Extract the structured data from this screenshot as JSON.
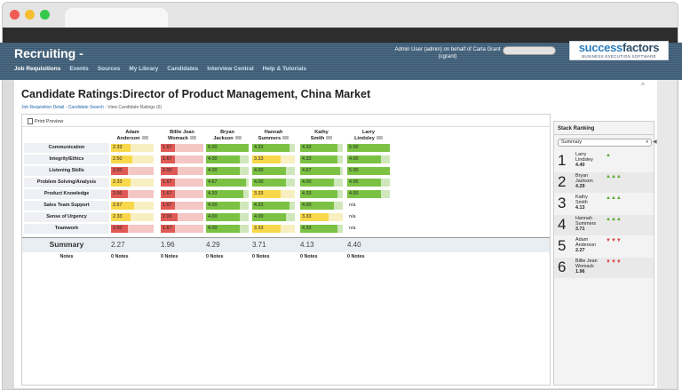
{
  "app": {
    "title": "Recruiting -",
    "admin_text": "Admin User (admin) on behalf of Carla Grant (cgrant)"
  },
  "logo": {
    "name_a": "success",
    "name_b": "factors",
    "tagline": "BUSINESS EXECUTION SOFTWARE"
  },
  "nav": [
    "Job Requisitions",
    "Events",
    "Sources",
    "My Library",
    "Candidates",
    "Interview Central",
    "Help & Tutorials"
  ],
  "page": {
    "title": "Candidate Ratings:Director of Product Management, China Market",
    "breadcrumb": {
      "link1": "Job Requisition Detail",
      "link2": "Candidate Search",
      "current": "View Candidate Ratings (6)"
    }
  },
  "toolbar": {
    "print_label": "Print Preview"
  },
  "colors": {
    "green": "#7bc143",
    "yellow": "#f8d84a",
    "red": "#e05a55",
    "header": "#3d5a72"
  },
  "candidates": [
    {
      "first": "Adam",
      "last": "Anderson"
    },
    {
      "first": "Billie Jean",
      "last": "Womack"
    },
    {
      "first": "Bryan",
      "last": "Jackson"
    },
    {
      "first": "Hannah",
      "last": "Summers"
    },
    {
      "first": "Kathy",
      "last": "Smith"
    },
    {
      "first": "Larry",
      "last": "Lindsley"
    }
  ],
  "criteria": [
    {
      "label": "Communication",
      "scores": [
        "2.33",
        "1.67",
        "5.00",
        "4.33",
        "4.33",
        "5.00"
      ]
    },
    {
      "label": "Integrity/Ethics",
      "scores": [
        "2.50",
        "1.67",
        "4.00",
        "3.33",
        "4.33",
        "4.00"
      ]
    },
    {
      "label": "Listening Skills",
      "scores": [
        "2.00",
        "2.00",
        "4.00",
        "4.00",
        "4.67",
        "5.00"
      ]
    },
    {
      "label": "Problem Solving/Analysis",
      "scores": [
        "2.33",
        "1.67",
        "4.67",
        "4.00",
        "4.00",
        "4.00"
      ]
    },
    {
      "label": "Product Knowledge",
      "scores": [
        "2.00",
        "1.67",
        "4.33",
        "3.33",
        "4.33",
        "4.00"
      ]
    },
    {
      "label": "Sales Team Support",
      "scores": [
        "2.67",
        "1.67",
        "4.00",
        "4.33",
        "4.00",
        "n/a"
      ]
    },
    {
      "label": "Sense of Urgency",
      "scores": [
        "2.33",
        "2.00",
        "4.00",
        "4.00",
        "3.33",
        "n/a"
      ]
    },
    {
      "label": "Teamwork",
      "scores": [
        "2.00",
        "1.67",
        "4.00",
        "3.33",
        "4.33",
        "n/a"
      ]
    }
  ],
  "summary": {
    "label": "Summary",
    "values": [
      "2.27",
      "1.96",
      "4.29",
      "3.71",
      "4.13",
      "4.40"
    ]
  },
  "notes": {
    "label": "Notes",
    "values": [
      "0 Notes",
      "0 Notes",
      "0 Notes",
      "0 Notes",
      "0 Notes",
      "0 Notes"
    ]
  },
  "stack": {
    "title": "Stack Ranking",
    "select_value": "Summary",
    "ranks": [
      {
        "num": "1",
        "first": "Larry",
        "last": "Lindsley",
        "score": "4.40",
        "thumbs": "up",
        "count": 1
      },
      {
        "num": "2",
        "first": "Bryan",
        "last": "Jackson",
        "score": "4.29",
        "thumbs": "up",
        "count": 3
      },
      {
        "num": "3",
        "first": "Kathy",
        "last": "Smith",
        "score": "4.13",
        "thumbs": "up",
        "count": 3
      },
      {
        "num": "4",
        "first": "Hannah",
        "last": "Summers",
        "score": "3.71",
        "thumbs": "up",
        "count": 3
      },
      {
        "num": "5",
        "first": "Adam",
        "last": "Anderson",
        "score": "2.27",
        "thumbs": "down",
        "count": 3
      },
      {
        "num": "6",
        "first": "Billie Jean",
        "last": "Womack",
        "score": "1.96",
        "thumbs": "down",
        "count": 3
      }
    ]
  }
}
